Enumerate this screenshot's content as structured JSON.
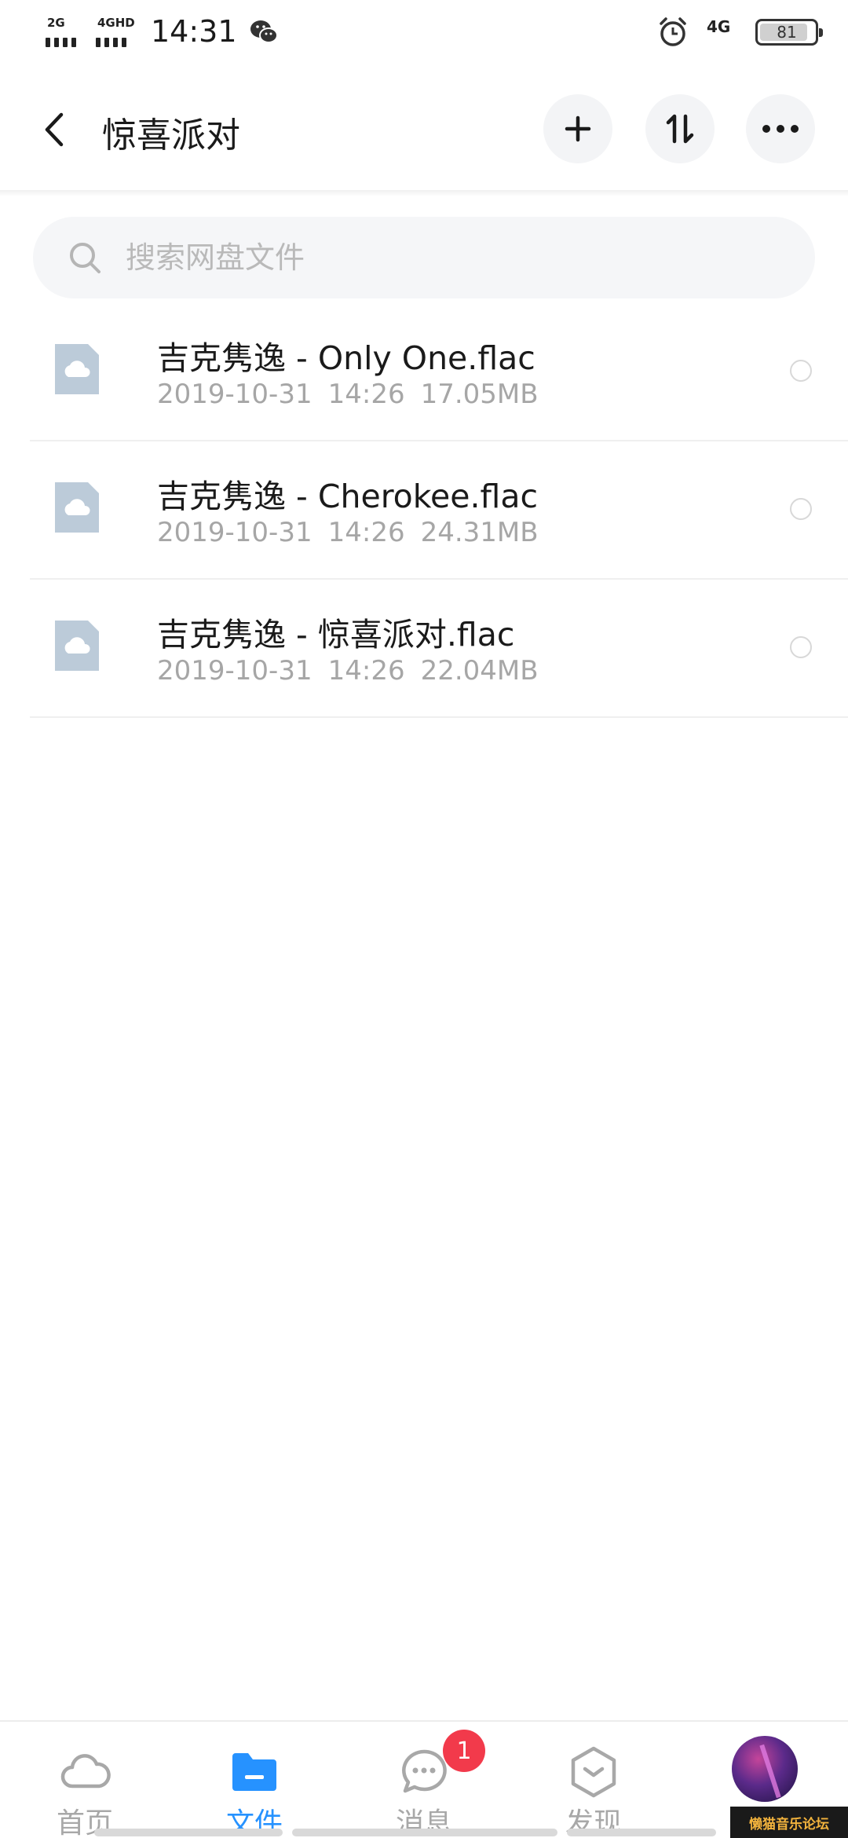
{
  "status_bar": {
    "signal1_label": "2G",
    "signal2_label": "4GHD",
    "time": "14:31",
    "network": "4G",
    "battery": "81",
    "icons": [
      "wechat-icon",
      "alarm-icon"
    ]
  },
  "header": {
    "title": "惊喜派对",
    "icons": [
      "back-icon",
      "plus-icon",
      "sort-icon",
      "more-icon"
    ]
  },
  "search": {
    "placeholder": "搜索网盘文件"
  },
  "files": [
    {
      "name": "吉克隽逸 - Only One.flac",
      "date": "2019-10-31",
      "time": "14:26",
      "size": "17.05MB"
    },
    {
      "name": "吉克隽逸 - Cherokee.flac",
      "date": "2019-10-31",
      "time": "14:26",
      "size": "24.31MB"
    },
    {
      "name": "吉克隽逸 - 惊喜派对.flac",
      "date": "2019-10-31",
      "time": "14:26",
      "size": "22.04MB"
    }
  ],
  "tabs": [
    {
      "label": "首页",
      "icon": "cloud-icon"
    },
    {
      "label": "文件",
      "icon": "folder-icon",
      "active": true
    },
    {
      "label": "消息",
      "icon": "chat-icon",
      "badge": "1"
    },
    {
      "label": "发现",
      "icon": "discover-icon"
    },
    {
      "label": "",
      "icon": "avatar"
    }
  ],
  "watermark": "懒猫音乐论坛",
  "colors": {
    "accent": "#2692ff",
    "badge": "#f23a4b",
    "file_icon": "#bccbd9"
  }
}
